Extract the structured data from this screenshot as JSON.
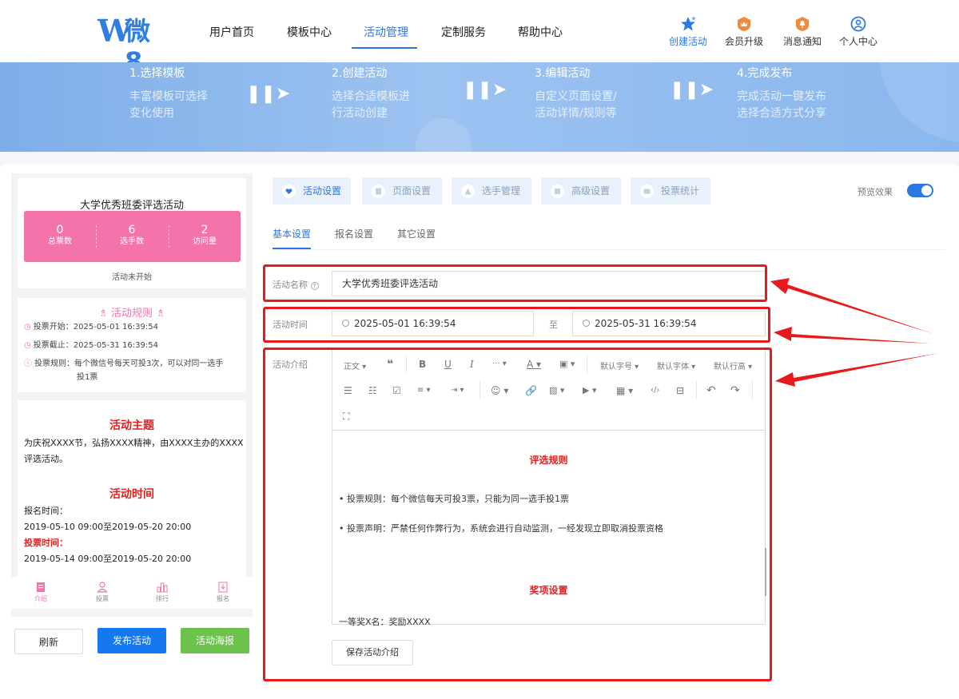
{
  "header": {
    "logo_text": "微8",
    "nav": [
      {
        "label": "用户首页"
      },
      {
        "label": "模板中心"
      },
      {
        "label": "活动管理"
      },
      {
        "label": "定制服务"
      },
      {
        "label": "帮助中心"
      }
    ],
    "actions": [
      {
        "label": "创建活动",
        "icon": "star-icon"
      },
      {
        "label": "会员升级",
        "icon": "crown-badge-icon"
      },
      {
        "label": "消息通知",
        "icon": "bell-badge-icon"
      },
      {
        "label": "个人中心",
        "icon": "user-circle-icon"
      }
    ],
    "accent": "#2b78e4"
  },
  "banner": {
    "steps": [
      {
        "title": "1.选择模板",
        "line1": "丰富模板可选择",
        "line2": "变化使用"
      },
      {
        "title": "2.创建活动",
        "line1": "选择合适模板进",
        "line2": "行活动创建"
      },
      {
        "title": "3.编辑活动",
        "line1": "自定义页面设置/",
        "line2": "活动详情/规则等"
      },
      {
        "title": "4.完成发布",
        "line1": "完成活动一键发布",
        "line2": "选择合适方式分享"
      }
    ]
  },
  "preview": {
    "activity_title": "大学优秀班委评选活动",
    "stats": [
      {
        "value": "0",
        "label": "总票数"
      },
      {
        "value": "6",
        "label": "选手数"
      },
      {
        "value": "2",
        "label": "访问量"
      }
    ],
    "status": "活动未开始",
    "rules_title": "活动规则",
    "rules": [
      {
        "text": "投票开始：2025-05-01 16:39:54"
      },
      {
        "text": "投票截止：2025-05-31 16:39:54"
      },
      {
        "text": "投票规则：每个微信号每天可投3次，可以对同一选手"
      },
      {
        "text": "投1票"
      }
    ],
    "theme_title": "活动主题",
    "theme_text": "为庆祝XXXX节，弘扬XXXX精神，由XXXX主办的XXXX评选活动。",
    "time_title": "活动时间",
    "signup_label": "报名时间：",
    "signup_time": "2019-05-10 09:00至2019-05-20 20:00",
    "vote_label": "投票时间：",
    "vote_time": "2019-05-14 09:00至2019-05-20 20:00",
    "tabs": [
      {
        "label": "介绍"
      },
      {
        "label": "投票"
      },
      {
        "label": "排行"
      },
      {
        "label": "报名"
      }
    ],
    "pink": "#f373aa"
  },
  "buttons": {
    "refresh": "刷新",
    "publish": "发布活动",
    "poster": "活动海报"
  },
  "settings": {
    "tabs": [
      {
        "label": "活动设置"
      },
      {
        "label": "页面设置"
      },
      {
        "label": "选手管理"
      },
      {
        "label": "高级设置"
      },
      {
        "label": "投票统计"
      }
    ],
    "preview_label": "预览效果",
    "preview_enabled": true,
    "subtabs": [
      {
        "label": "基本设置"
      },
      {
        "label": "报名设置"
      },
      {
        "label": "其它设置"
      }
    ],
    "name_label": "活动名称",
    "name_value": "大学优秀班委评选活动",
    "time_label": "活动时间",
    "time_start": "2025-05-01 16:39:54",
    "time_sep": "至",
    "time_end": "2025-05-31 16:39:54",
    "intro_label": "活动介绍",
    "toolbar": {
      "paragraph": "正文",
      "font_size": "默认字号",
      "font_family": "默认字体",
      "line_height": "默认行高"
    },
    "editor": {
      "heading1": "评选规则",
      "bullet1": "•  投票规则：每个微信每天可投3票，只能为同一选手投1票",
      "bullet2": "•  投票声明：严禁任何作弊行为，系统会进行自动监测，一经发现立即取消投票资格",
      "heading2": "奖项设置",
      "prize1": "一等奖X名：奖励XXXX"
    },
    "save_label": "保存活动介绍"
  },
  "annotation_color": "#e8191a"
}
